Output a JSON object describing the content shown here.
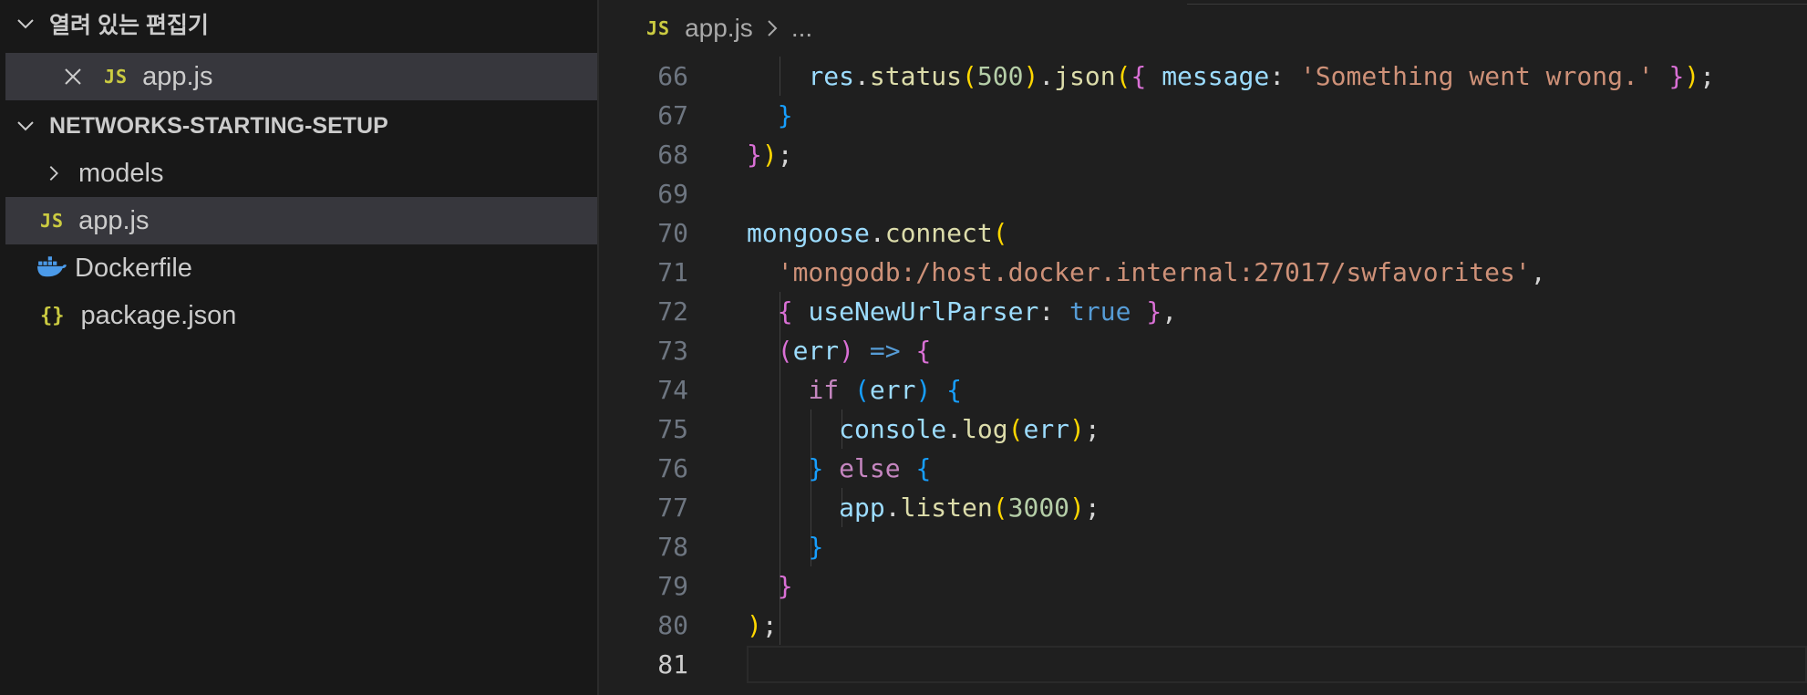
{
  "sidebar": {
    "open_editors": {
      "title": "열려 있는 편집기",
      "items": [
        {
          "badge": "JS",
          "label": "app.js"
        }
      ]
    },
    "project": {
      "title": "NETWORKS-STARTING-SETUP",
      "items": [
        {
          "label": "models",
          "kind": "folder",
          "icon": "chevron-right-icon"
        },
        {
          "label": "app.js",
          "kind": "file",
          "badge": "JS",
          "icon": "js-file-icon"
        },
        {
          "label": "Dockerfile",
          "kind": "file",
          "icon": "docker-whale-icon"
        },
        {
          "label": "package.json",
          "kind": "file",
          "badge": "{}",
          "icon": "json-file-icon"
        }
      ]
    }
  },
  "editor": {
    "breadcrumb": {
      "badge": "JS",
      "file": "app.js",
      "rest": "..."
    },
    "active_line": "81",
    "lines": [
      {
        "num": "66",
        "tokens": [
          [
            "    ",
            "plain"
          ],
          [
            "res",
            "var"
          ],
          [
            ".",
            "plain"
          ],
          [
            "status",
            "fn"
          ],
          [
            "(",
            "b1"
          ],
          [
            "500",
            "num"
          ],
          [
            ")",
            "b1"
          ],
          [
            ".",
            "plain"
          ],
          [
            "json",
            "fn"
          ],
          [
            "(",
            "b1"
          ],
          [
            "{",
            "b2"
          ],
          [
            " ",
            "plain"
          ],
          [
            "message",
            "var"
          ],
          [
            ": ",
            "plain"
          ],
          [
            "'Something went wrong.'",
            "str"
          ],
          [
            " ",
            "plain"
          ],
          [
            "}",
            "b2"
          ],
          [
            ")",
            "b1"
          ],
          [
            ";",
            "plain"
          ]
        ]
      },
      {
        "num": "67",
        "tokens": [
          [
            "  ",
            "plain"
          ],
          [
            "}",
            "b3"
          ]
        ]
      },
      {
        "num": "68",
        "tokens": [
          [
            "}",
            "b2"
          ],
          [
            ")",
            "b1"
          ],
          [
            ";",
            "plain"
          ]
        ]
      },
      {
        "num": "69",
        "tokens": []
      },
      {
        "num": "70",
        "tokens": [
          [
            "mongoose",
            "var"
          ],
          [
            ".",
            "plain"
          ],
          [
            "connect",
            "fn"
          ],
          [
            "(",
            "b1"
          ]
        ]
      },
      {
        "num": "71",
        "tokens": [
          [
            "  ",
            "plain"
          ],
          [
            "'mongodb:/host.docker.internal:27017/swfavorites'",
            "str"
          ],
          [
            ",",
            "plain"
          ]
        ]
      },
      {
        "num": "72",
        "tokens": [
          [
            "  ",
            "plain"
          ],
          [
            "{",
            "b2"
          ],
          [
            " ",
            "plain"
          ],
          [
            "useNewUrlParser",
            "var"
          ],
          [
            ": ",
            "plain"
          ],
          [
            "true",
            "bool"
          ],
          [
            " ",
            "plain"
          ],
          [
            "}",
            "b2"
          ],
          [
            ",",
            "plain"
          ]
        ]
      },
      {
        "num": "73",
        "tokens": [
          [
            "  ",
            "plain"
          ],
          [
            "(",
            "b2"
          ],
          [
            "err",
            "var"
          ],
          [
            ")",
            "b2"
          ],
          [
            " ",
            "plain"
          ],
          [
            "=>",
            "arrow"
          ],
          [
            " ",
            "plain"
          ],
          [
            "{",
            "b2"
          ]
        ]
      },
      {
        "num": "74",
        "tokens": [
          [
            "    ",
            "plain"
          ],
          [
            "if",
            "kw"
          ],
          [
            " ",
            "plain"
          ],
          [
            "(",
            "b3"
          ],
          [
            "err",
            "var"
          ],
          [
            ")",
            "b3"
          ],
          [
            " ",
            "plain"
          ],
          [
            "{",
            "b3"
          ]
        ]
      },
      {
        "num": "75",
        "tokens": [
          [
            "      ",
            "plain"
          ],
          [
            "console",
            "var"
          ],
          [
            ".",
            "plain"
          ],
          [
            "log",
            "fn"
          ],
          [
            "(",
            "b1"
          ],
          [
            "err",
            "var"
          ],
          [
            ")",
            "b1"
          ],
          [
            ";",
            "plain"
          ]
        ]
      },
      {
        "num": "76",
        "tokens": [
          [
            "    ",
            "plain"
          ],
          [
            "}",
            "b3"
          ],
          [
            " ",
            "plain"
          ],
          [
            "else",
            "kw"
          ],
          [
            " ",
            "plain"
          ],
          [
            "{",
            "b3"
          ]
        ]
      },
      {
        "num": "77",
        "tokens": [
          [
            "      ",
            "plain"
          ],
          [
            "app",
            "var"
          ],
          [
            ".",
            "plain"
          ],
          [
            "listen",
            "fn"
          ],
          [
            "(",
            "b1"
          ],
          [
            "3000",
            "num"
          ],
          [
            ")",
            "b1"
          ],
          [
            ";",
            "plain"
          ]
        ]
      },
      {
        "num": "78",
        "tokens": [
          [
            "    ",
            "plain"
          ],
          [
            "}",
            "b3"
          ]
        ]
      },
      {
        "num": "79",
        "tokens": [
          [
            "  ",
            "plain"
          ],
          [
            "}",
            "b2"
          ]
        ]
      },
      {
        "num": "80",
        "tokens": [
          [
            ")",
            "b1"
          ],
          [
            ";",
            "plain"
          ]
        ]
      },
      {
        "num": "81",
        "tokens": []
      }
    ]
  },
  "colors": {
    "sidebar_bg": "#181818",
    "editor_bg": "#1f1f1f",
    "selection_bg": "#37373d",
    "js_badge": "#cbcb41",
    "docker_blue": "#4b9ae9"
  }
}
